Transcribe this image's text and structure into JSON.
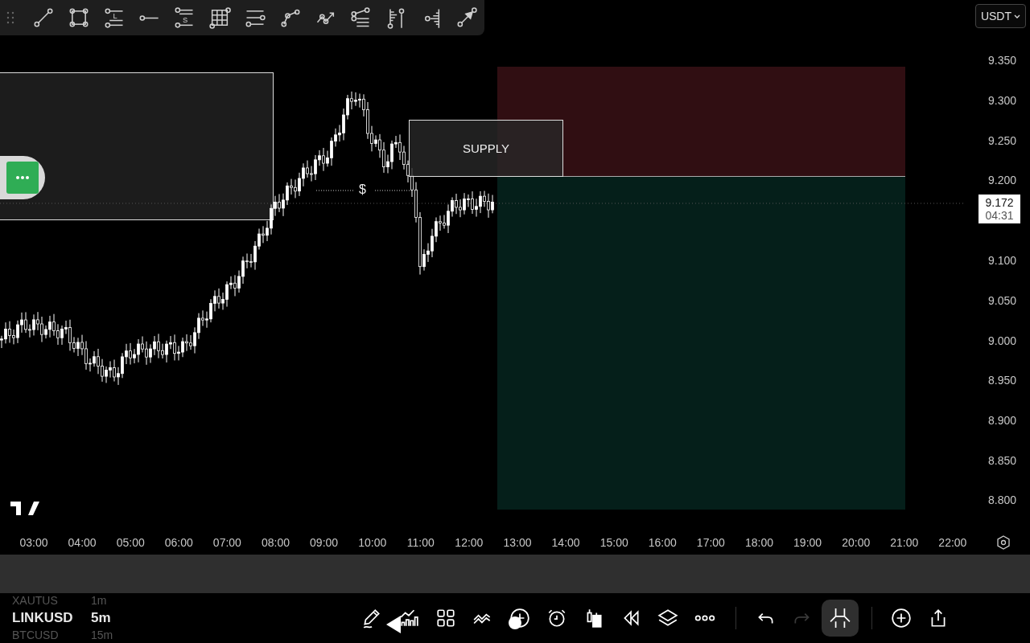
{
  "drawing_toolbar": {
    "tools": [
      {
        "kind": "trend-line"
      },
      {
        "kind": "rectangle"
      },
      {
        "kind": "long-position",
        "label": "L"
      },
      {
        "kind": "horizontal-ray"
      },
      {
        "kind": "price-label",
        "label": "S"
      },
      {
        "kind": "gann-box"
      },
      {
        "kind": "parallel-channel"
      },
      {
        "kind": "path"
      },
      {
        "kind": "arrow-path"
      },
      {
        "kind": "pitchfork"
      },
      {
        "kind": "volume-profile"
      },
      {
        "kind": "fixed-range"
      },
      {
        "kind": "arrow"
      }
    ]
  },
  "currency_dropdown": {
    "value": "USDT"
  },
  "price_axis": {
    "labels": [
      "9.350",
      "9.300",
      "9.250",
      "9.200",
      "9.100",
      "9.050",
      "9.000",
      "8.950",
      "8.900",
      "8.850",
      "8.800"
    ],
    "current_price": "9.172",
    "countdown": "04:31"
  },
  "chart": {
    "supply_zone": {
      "label": "SUPPLY"
    },
    "price_marker": {
      "label": "$"
    }
  },
  "time_axis": {
    "labels": [
      "03:00",
      "04:00",
      "05:00",
      "06:00",
      "07:00",
      "08:00",
      "09:00",
      "10:00",
      "11:00",
      "12:00",
      "13:00",
      "14:00",
      "15:00",
      "16:00",
      "17:00",
      "18:00",
      "19:00",
      "20:00",
      "21:00",
      "22:00"
    ]
  },
  "watchlist": [
    {
      "symbol": "XAUTUS",
      "interval": "1m",
      "selected": false
    },
    {
      "symbol": "LINKUSD",
      "interval": "5m",
      "selected": true
    },
    {
      "symbol": "BTCUSD",
      "interval": "15m",
      "selected": false
    }
  ],
  "bottom_toolbar": {
    "buttons": [
      {
        "kind": "pencil",
        "disabled": false
      },
      {
        "kind": "indicators",
        "disabled": false
      },
      {
        "kind": "layout",
        "disabled": false
      },
      {
        "kind": "compare",
        "disabled": false
      },
      {
        "kind": "add",
        "disabled": false
      },
      {
        "kind": "alarm",
        "disabled": false
      },
      {
        "kind": "candles",
        "disabled": false
      },
      {
        "kind": "replay",
        "disabled": false
      },
      {
        "kind": "layers",
        "disabled": false
      },
      {
        "kind": "more",
        "disabled": false
      },
      {
        "kind": "divider"
      },
      {
        "kind": "undo",
        "disabled": false
      },
      {
        "kind": "redo",
        "disabled": true
      },
      {
        "kind": "branch",
        "disabled": false
      },
      {
        "kind": "divider"
      },
      {
        "kind": "add-alt",
        "disabled": false
      },
      {
        "kind": "share",
        "disabled": false
      }
    ]
  }
}
